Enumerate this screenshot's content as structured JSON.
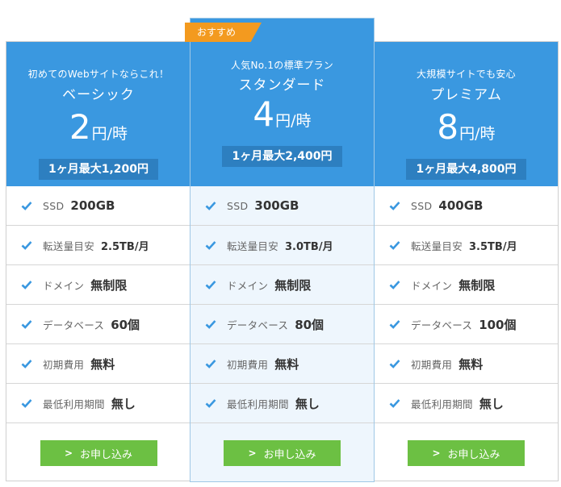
{
  "plans": [
    {
      "badge": "",
      "subtitle": "初めてのWebサイトならこれ！",
      "name": "ベーシック",
      "price": "2",
      "price_unit": "円/時",
      "monthly": "1ヶ月最大1,200円",
      "features": [
        {
          "label": "SSD",
          "value": "200GB"
        },
        {
          "label": "転送量目安",
          "value": "2.5TB/月"
        },
        {
          "label": "ドメイン",
          "value": "無制限"
        },
        {
          "label": "データベース",
          "value": "60個"
        },
        {
          "label": "初期費用",
          "value": "無料"
        },
        {
          "label": "最低利用期間",
          "value": "無し"
        }
      ],
      "cta": "お申し込み"
    },
    {
      "badge": "おすすめ",
      "subtitle": "人気No.1の標準プラン",
      "name": "スタンダード",
      "price": "4",
      "price_unit": "円/時",
      "monthly": "1ヶ月最大2,400円",
      "features": [
        {
          "label": "SSD",
          "value": "300GB"
        },
        {
          "label": "転送量目安",
          "value": "3.0TB/月"
        },
        {
          "label": "ドメイン",
          "value": "無制限"
        },
        {
          "label": "データベース",
          "value": "80個"
        },
        {
          "label": "初期費用",
          "value": "無料"
        },
        {
          "label": "最低利用期間",
          "value": "無し"
        }
      ],
      "cta": "お申し込み"
    },
    {
      "badge": "",
      "subtitle": "大規模サイトでも安心",
      "name": "プレミアム",
      "price": "8",
      "price_unit": "円/時",
      "monthly": "1ヶ月最大4,800円",
      "features": [
        {
          "label": "SSD",
          "value": "400GB"
        },
        {
          "label": "転送量目安",
          "value": "3.5TB/月"
        },
        {
          "label": "ドメイン",
          "value": "無制限"
        },
        {
          "label": "データベース",
          "value": "100個"
        },
        {
          "label": "初期費用",
          "value": "無料"
        },
        {
          "label": "最低利用期間",
          "value": "無し"
        }
      ],
      "cta": "お申し込み"
    }
  ],
  "colors": {
    "header_blue": "#3a98e0",
    "monthly_bg": "#2d7fc0",
    "badge_orange": "#f39a1f",
    "cta_green": "#6cc043",
    "check_blue": "#3a98e0",
    "highlight_bg": "#eef6fd"
  }
}
